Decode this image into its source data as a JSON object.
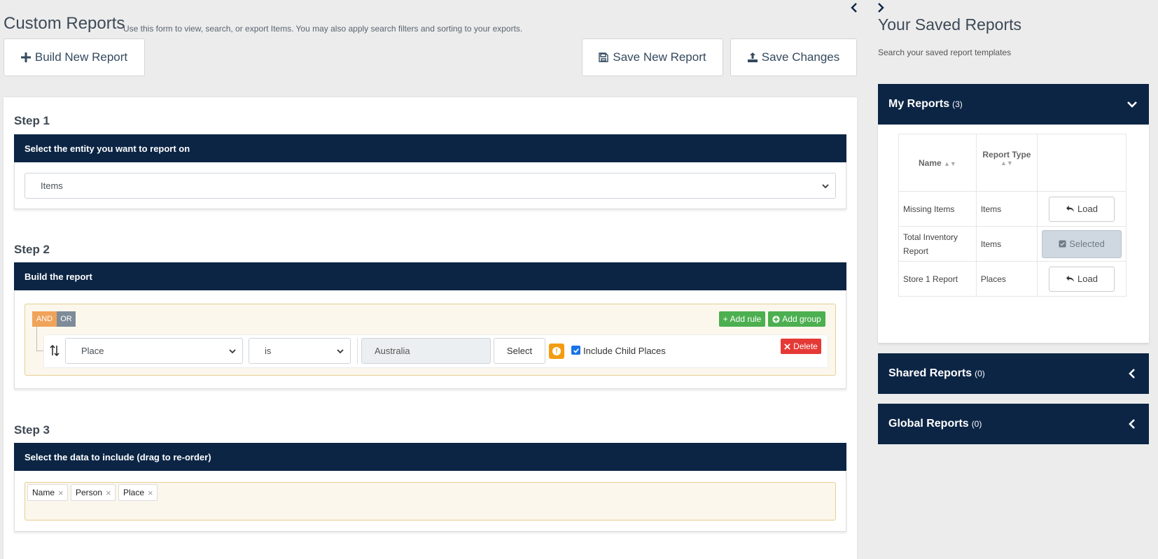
{
  "header": {
    "title": "Custom Reports",
    "subtitle": "Use this form to view, search, or export Items. You may also apply search filters and sorting to your exports.",
    "build_label": "Build New Report",
    "save_new_label": "Save New Report",
    "save_changes_label": "Save Changes"
  },
  "step1": {
    "title": "Step 1",
    "bar": "Select the entity you want to report on",
    "entity": "Items"
  },
  "step2": {
    "title": "Step 2",
    "bar": "Build the report",
    "and": "AND",
    "or": "OR",
    "add_rule": "Add rule",
    "add_group": "Add group",
    "field": "Place",
    "operator": "is",
    "value": "Australia",
    "select_label": "Select",
    "delete_label": "Delete",
    "include_child": "Include Child Places"
  },
  "step3": {
    "title": "Step 3",
    "bar": "Select the data to include (drag to re-order)",
    "chips": [
      "Name",
      "Person",
      "Place"
    ]
  },
  "side": {
    "title": "Your Saved Reports",
    "subtitle": "Search your saved report templates",
    "my_reports": {
      "label": "My Reports",
      "count": "(3)"
    },
    "shared_reports": {
      "label": "Shared Reports",
      "count": "(0)"
    },
    "global_reports": {
      "label": "Global Reports",
      "count": "(0)"
    },
    "table": {
      "col_name": "Name",
      "col_type": "Report Type",
      "rows": [
        {
          "name": "Missing Items",
          "type": "Items",
          "action": "Load"
        },
        {
          "name": "Total Inventory Report",
          "type": "Items",
          "action": "Selected"
        },
        {
          "name": "Store 1 Report",
          "type": "Places",
          "action": "Load"
        }
      ]
    }
  },
  "colors": {
    "navy": "#0c2545",
    "green": "#4caf50",
    "red": "#e53935",
    "orange": "#f0a35a"
  }
}
